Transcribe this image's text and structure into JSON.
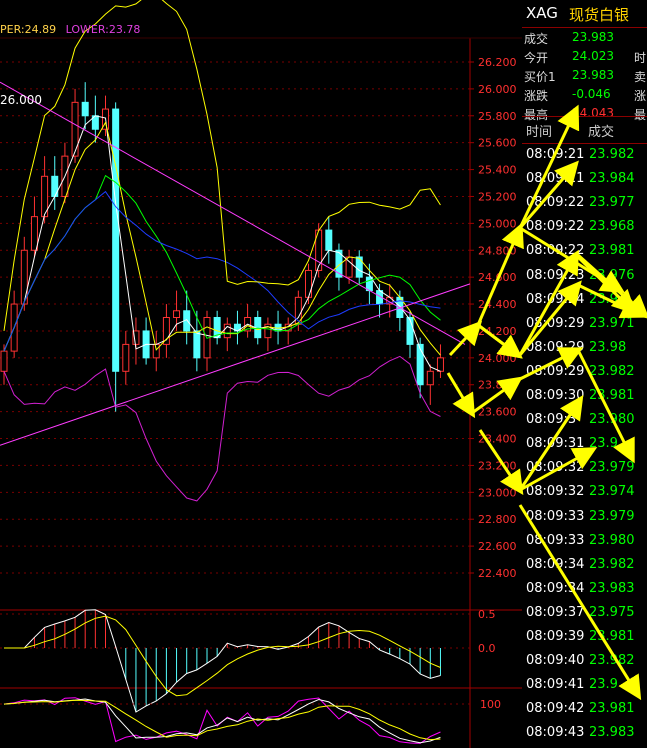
{
  "legend": {
    "upper": "PER:24.89",
    "lower": "LOWER:23.78"
  },
  "annotation": "26.000",
  "colors": {
    "up": "#ff3232",
    "down": "#54ffff",
    "ma1": "#ffffff",
    "ma2": "#ffff00",
    "ma3": "#ff00ff",
    "ma4": "#00ff00",
    "ma5": "#1e3cff",
    "boll": "#ffff00",
    "bollLow": "#d020d0",
    "trend": "#ff3cff",
    "arrow": "#ffff00",
    "grid": "#7a0000",
    "axis": "#a00000",
    "tick": "#ff3030",
    "quoteGreen": "#00ff00",
    "quoteRed": "#ff3030"
  },
  "chart_data": [
    {
      "type": "candlestick",
      "ylim": [
        22.2,
        26.4
      ],
      "yticks": [
        "26.200",
        "26.000",
        "25.800",
        "25.600",
        "25.400",
        "25.200",
        "25.000",
        "24.800",
        "24.600",
        "24.400",
        "24.200",
        "24.000",
        "23.800",
        "23.600",
        "23.400",
        "23.200",
        "23.000",
        "22.800",
        "22.600",
        "22.400"
      ],
      "candles": [
        [
          23.9,
          24.1,
          23.8,
          24.05
        ],
        [
          24.05,
          24.5,
          24.0,
          24.4
        ],
        [
          24.4,
          24.9,
          24.35,
          24.8
        ],
        [
          24.8,
          25.2,
          24.75,
          25.05
        ],
        [
          25.05,
          25.5,
          25.0,
          25.35
        ],
        [
          25.35,
          25.5,
          25.1,
          25.2
        ],
        [
          25.2,
          25.6,
          25.15,
          25.5
        ],
        [
          25.5,
          26.0,
          25.45,
          25.9
        ],
        [
          25.9,
          26.05,
          25.7,
          25.8
        ],
        [
          25.8,
          25.95,
          25.6,
          25.7
        ],
        [
          25.7,
          25.95,
          25.65,
          25.85
        ],
        [
          25.85,
          25.9,
          23.6,
          23.9
        ],
        [
          23.9,
          24.2,
          23.8,
          24.1
        ],
        [
          24.1,
          24.3,
          23.95,
          24.2
        ],
        [
          24.2,
          24.3,
          23.95,
          24.0
        ],
        [
          24.0,
          24.2,
          23.9,
          24.1
        ],
        [
          24.1,
          24.4,
          24.0,
          24.3
        ],
        [
          24.3,
          24.5,
          24.2,
          24.35
        ],
        [
          24.35,
          24.5,
          24.1,
          24.2
        ],
        [
          24.2,
          24.35,
          23.9,
          24.0
        ],
        [
          24.0,
          24.35,
          23.9,
          24.3
        ],
        [
          24.3,
          24.35,
          24.1,
          24.15
        ],
        [
          24.15,
          24.3,
          24.05,
          24.25
        ],
        [
          24.25,
          24.35,
          24.1,
          24.2
        ],
        [
          24.2,
          24.4,
          24.15,
          24.3
        ],
        [
          24.3,
          24.35,
          24.1,
          24.15
        ],
        [
          24.15,
          24.3,
          24.05,
          24.25
        ],
        [
          24.25,
          24.35,
          24.1,
          24.2
        ],
        [
          24.2,
          24.3,
          24.1,
          24.25
        ],
        [
          24.25,
          24.5,
          24.2,
          24.45
        ],
        [
          24.45,
          24.7,
          24.4,
          24.65
        ],
        [
          24.65,
          25.0,
          24.6,
          24.95
        ],
        [
          24.95,
          25.05,
          24.7,
          24.8
        ],
        [
          24.8,
          24.85,
          24.5,
          24.6
        ],
        [
          24.6,
          24.8,
          24.55,
          24.75
        ],
        [
          24.75,
          24.8,
          24.55,
          24.6
        ],
        [
          24.6,
          24.7,
          24.4,
          24.5
        ],
        [
          24.5,
          24.55,
          24.3,
          24.4
        ],
        [
          24.4,
          24.55,
          24.3,
          24.45
        ],
        [
          24.45,
          24.5,
          24.2,
          24.3
        ],
        [
          24.3,
          24.35,
          24.0,
          24.1
        ],
        [
          24.1,
          24.15,
          23.7,
          23.8
        ],
        [
          23.8,
          23.95,
          23.65,
          23.9
        ],
        [
          23.9,
          24.1,
          23.85,
          24.0
        ]
      ]
    },
    {
      "type": "bar",
      "name": "MACD",
      "yticks": [
        "0.5",
        "0.0"
      ],
      "ylim": [
        -0.6,
        0.6
      ]
    },
    {
      "type": "line",
      "name": "Oscillator",
      "yticks": [
        "100"
      ],
      "ylim": [
        0,
        110
      ]
    }
  ],
  "quote": {
    "symbol": "XAG",
    "name": "现货白银",
    "rows": [
      {
        "label": "成交",
        "value": "23.983",
        "extra": ""
      },
      {
        "label": "今开",
        "value": "24.023",
        "extra": "时"
      },
      {
        "label": "买价1",
        "value": "23.983",
        "extra": "卖"
      },
      {
        "label": "涨跌",
        "value": "-0.046",
        "extra": "涨"
      },
      {
        "label": "最高",
        "value": "24.043",
        "extra": "最"
      }
    ],
    "col_time": "时间",
    "col_price": "成交",
    "ticks": [
      {
        "time": "08:09:21",
        "price": "23.982"
      },
      {
        "time": "08:09:21",
        "price": "23.984"
      },
      {
        "time": "08:09:22",
        "price": "23.977"
      },
      {
        "time": "08:09:22",
        "price": "23.968"
      },
      {
        "time": "08:09:22",
        "price": "23.981"
      },
      {
        "time": "08:09:23",
        "price": "23.976"
      },
      {
        "time": "08:09:24",
        "price": "23.9"
      },
      {
        "time": "08:09:29",
        "price": "23.971"
      },
      {
        "time": "08:09:29",
        "price": "23.98"
      },
      {
        "time": "08:09:29",
        "price": "23.982"
      },
      {
        "time": "08:09:30",
        "price": "23.981"
      },
      {
        "time": "08:09:3",
        "price": "23.980"
      },
      {
        "time": "08:09:31",
        "price": "23.9"
      },
      {
        "time": "08:09:32",
        "price": "23.979"
      },
      {
        "time": "08:09:32",
        "price": "23.974"
      },
      {
        "time": "08:09:33",
        "price": "23.979"
      },
      {
        "time": "08:09:33",
        "price": "23.980"
      },
      {
        "time": "08:09:34",
        "price": "23.982"
      },
      {
        "time": "08:09:34",
        "price": "23.983"
      },
      {
        "time": "08:09:37",
        "price": "23.975"
      },
      {
        "time": "08:09:39",
        "price": "23.981"
      },
      {
        "time": "08:09:40",
        "price": "23.982"
      },
      {
        "time": "08:09:41",
        "price": "23.9"
      },
      {
        "time": "08:09:42",
        "price": "23.981"
      },
      {
        "time": "08:09:43",
        "price": "23.983"
      }
    ]
  }
}
